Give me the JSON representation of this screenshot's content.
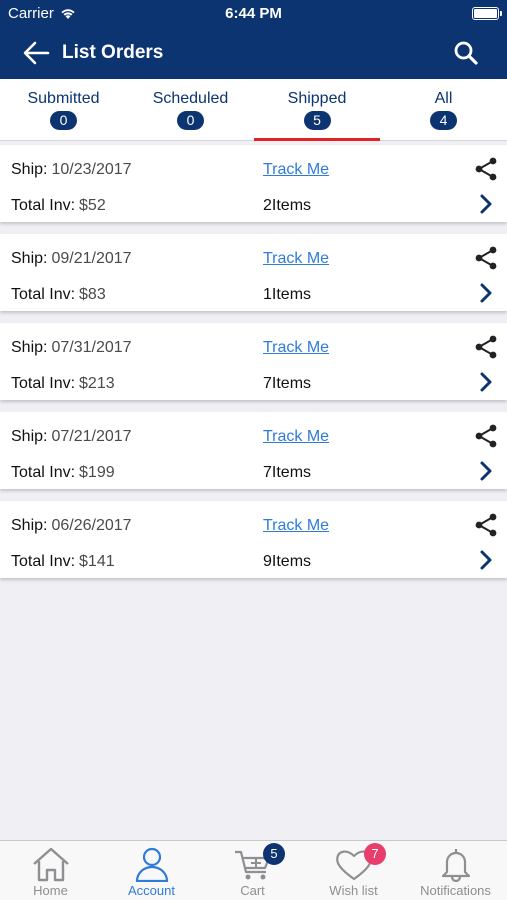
{
  "status_bar": {
    "carrier": "Carrier",
    "time": "6:44 PM"
  },
  "header": {
    "title": "List Orders",
    "back_icon": "back-arrow-icon",
    "search_icon": "search-icon"
  },
  "tabs": [
    {
      "label": "Submitted",
      "count": "0"
    },
    {
      "label": "Scheduled",
      "count": "0"
    },
    {
      "label": "Shipped",
      "count": "5",
      "active": true
    },
    {
      "label": "All",
      "count": "4"
    }
  ],
  "order_labels": {
    "ship": "Ship:",
    "total": "Total Inv:",
    "track": "Track Me",
    "items": "Items"
  },
  "orders": [
    {
      "ship_date": "10/23/2017",
      "total": "$52",
      "items_count": "2"
    },
    {
      "ship_date": "09/21/2017",
      "total": "$83",
      "items_count": "1"
    },
    {
      "ship_date": "07/31/2017",
      "total": "$213",
      "items_count": "7"
    },
    {
      "ship_date": "07/21/2017",
      "total": "$199",
      "items_count": "7"
    },
    {
      "ship_date": "06/26/2017",
      "total": "$141",
      "items_count": "9"
    }
  ],
  "tab_bar": [
    {
      "label": "Home",
      "icon": "home-icon"
    },
    {
      "label": "Account",
      "icon": "account-icon",
      "active": true
    },
    {
      "label": "Cart",
      "icon": "cart-icon",
      "badge": "5"
    },
    {
      "label": "Wish list",
      "icon": "heart-icon",
      "badge": "7"
    },
    {
      "label": "Notifications",
      "icon": "bell-icon"
    }
  ],
  "colors": {
    "primary": "#0b3470",
    "accent_red": "#e12226",
    "link_blue": "#2f7bd8",
    "cart_badge": "#0b3470",
    "wishlist_badge": "#e83e6c"
  }
}
